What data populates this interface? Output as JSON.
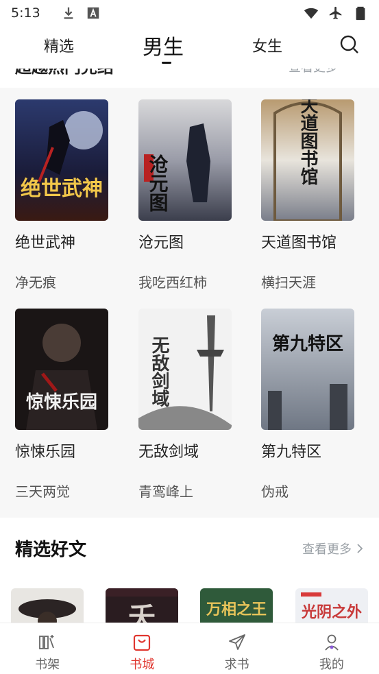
{
  "status_bar": {
    "time": "5:13",
    "left_icons": [
      "download-icon",
      "a-icon"
    ],
    "right_icons": [
      "wifi-icon",
      "airplane-icon",
      "battery-icon"
    ]
  },
  "top_tabs": {
    "tabs": [
      {
        "label": "精选",
        "active": false
      },
      {
        "label": "男生",
        "active": true
      },
      {
        "label": "女生",
        "active": false
      }
    ],
    "search_icon": "search-icon"
  },
  "partial_section": {
    "title": "超越热门完结",
    "more": "查看更多"
  },
  "books": [
    {
      "title": "绝世武神",
      "author": "净无痕",
      "cover_text": "绝世武神"
    },
    {
      "title": "沧元图",
      "author": "我吃西红柿",
      "cover_text": "沧元图"
    },
    {
      "title": "天道图书馆",
      "author": "横扫天涯",
      "cover_text": "天道图书馆"
    },
    {
      "title": "惊悚乐园",
      "author": "三天两觉",
      "cover_text": "惊悚乐园"
    },
    {
      "title": "无敌剑域",
      "author": "青鸾峰上",
      "cover_text": "无敌剑域"
    },
    {
      "title": "第九特区",
      "author": "伪戒",
      "cover_text": "第九特区"
    }
  ],
  "featured": {
    "title": "精选好文",
    "more": "查看更多",
    "covers": [
      {
        "cover_text": ""
      },
      {
        "cover_text": "夭"
      },
      {
        "cover_text": "万相之王"
      },
      {
        "cover_text": "光阴之外"
      }
    ]
  },
  "bottom_nav": {
    "items": [
      {
        "label": "书架",
        "icon": "bookshelf-icon",
        "active": false
      },
      {
        "label": "书城",
        "icon": "bookstore-bag-icon",
        "active": true
      },
      {
        "label": "求书",
        "icon": "paper-plane-icon",
        "active": false
      },
      {
        "label": "我的",
        "icon": "user-icon",
        "active": false
      }
    ]
  },
  "colors": {
    "accent": "#e0362f",
    "muted": "#9aa0a6",
    "section_bg": "#f7f7f7"
  }
}
